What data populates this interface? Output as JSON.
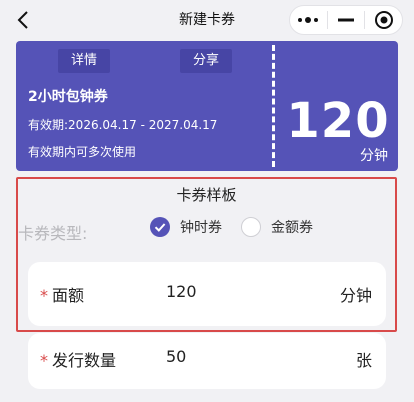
{
  "nav": {
    "title": "新建卡券",
    "back_icon": "chevron-left-icon",
    "capsule": [
      "more-dots-icon",
      "minimize-icon",
      "target-icon"
    ]
  },
  "coupon": {
    "detail_label": "详情",
    "share_label": "分享",
    "name": "2小时包钟券",
    "validity": "有效期:2026.04.17 - 2027.04.17",
    "note": "有效期内可多次使用",
    "amount": "120",
    "unit": "分钟",
    "color": "#5553b7"
  },
  "template": {
    "title": "卡券样板",
    "type_label": "卡券类型:",
    "options": [
      {
        "label": "钟时券",
        "selected": true
      },
      {
        "label": "金额券",
        "selected": false
      }
    ],
    "highlight_color": "#d84a4a"
  },
  "fields": {
    "face_value": {
      "required_mark": "*",
      "label": "面额",
      "value": "120",
      "unit": "分钟"
    },
    "quantity": {
      "required_mark": "*",
      "label": "发行数量",
      "value": "50",
      "unit": "张"
    }
  }
}
